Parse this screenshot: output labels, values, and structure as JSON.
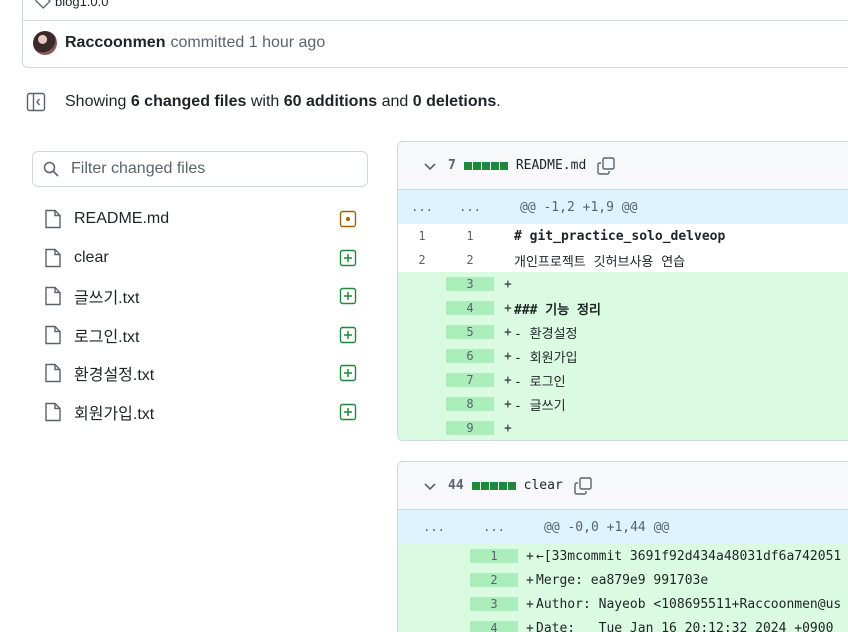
{
  "commit": {
    "tag": "blog1.0.0",
    "author": "Raccoonmen",
    "action": "committed",
    "time": "1 hour ago"
  },
  "summary": {
    "showing": "Showing ",
    "files": "6 changed files",
    "with": " with ",
    "additions": "60 additions",
    "and": " and ",
    "deletions": "0 deletions",
    "period": "."
  },
  "filter": {
    "placeholder": "Filter changed files"
  },
  "files": [
    {
      "name": "README.md",
      "status": "modified"
    },
    {
      "name": "clear",
      "status": "added"
    },
    {
      "name": "글쓰기.txt",
      "status": "added"
    },
    {
      "name": "로그인.txt",
      "status": "added"
    },
    {
      "name": "환경설정.txt",
      "status": "added"
    },
    {
      "name": "회원가입.txt",
      "status": "added"
    }
  ],
  "diffs": [
    {
      "count": "7",
      "filename": "README.md",
      "hunk": {
        "old": "...",
        "new": "...",
        "text": "@@ -1,2 +1,9 @@"
      },
      "lines": [
        {
          "old": "1",
          "new": "1",
          "type": "ctx",
          "text": "# git_practice_solo_delveop"
        },
        {
          "old": "2",
          "new": "2",
          "type": "ctx",
          "text": "개인프로젝트 깃허브사용 연습"
        },
        {
          "old": "",
          "new": "3",
          "type": "add",
          "text": ""
        },
        {
          "old": "",
          "new": "4",
          "type": "add",
          "text": "### 기능 정리"
        },
        {
          "old": "",
          "new": "5",
          "type": "add",
          "text": "- 환경설정"
        },
        {
          "old": "",
          "new": "6",
          "type": "add",
          "text": "- 회원가입"
        },
        {
          "old": "",
          "new": "7",
          "type": "add",
          "text": "- 로그인"
        },
        {
          "old": "",
          "new": "8",
          "type": "add",
          "text": "- 글쓰기"
        },
        {
          "old": "",
          "new": "9",
          "type": "add",
          "text": ""
        }
      ]
    },
    {
      "count": "44",
      "filename": "clear",
      "hunk": {
        "old": "...",
        "new": "...",
        "text": "@@ -0,0 +1,44 @@"
      },
      "lines": [
        {
          "old": "",
          "new": "1",
          "type": "add",
          "text": "←[33mcommit 3691f92d434a48031df6a742051"
        },
        {
          "old": "",
          "new": "2",
          "type": "add",
          "text": "Merge: ea879e9 991703e"
        },
        {
          "old": "",
          "new": "3",
          "type": "add",
          "text": "Author: Nayeob <108695511+Raccoonmen@us"
        },
        {
          "old": "",
          "new": "4",
          "type": "add",
          "text": "Date:   Tue Jan 16 20:12:32 2024 +0900"
        }
      ]
    }
  ],
  "colors": {
    "added": "#1f883d",
    "modified": "#9a6700",
    "hunk_bg": "#ddf4ff",
    "add_bg": "#dafbe1"
  },
  "icons": [
    "tag-icon",
    "sidebar-toggle-icon",
    "search-icon",
    "file-icon",
    "diff-added-icon",
    "diff-modified-icon",
    "chevron-down-icon",
    "copy-icon"
  ]
}
